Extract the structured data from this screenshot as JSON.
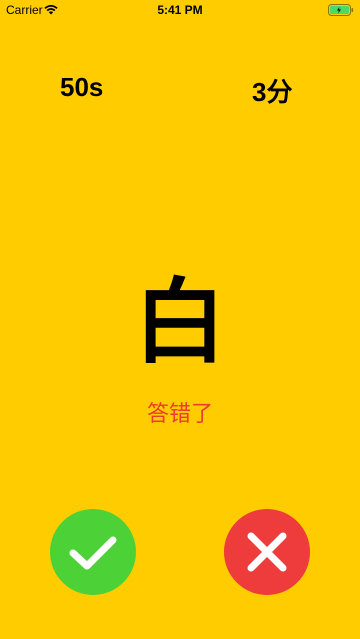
{
  "status_bar": {
    "carrier": "Carrier",
    "time": "5:41 PM",
    "wifi_icon": "wifi-icon",
    "battery_icon": "battery-icon"
  },
  "game": {
    "timer": "50s",
    "score": "3分",
    "character": "白",
    "feedback": "答错了"
  },
  "buttons": {
    "correct": {
      "icon": "checkmark-icon",
      "color": "#4CD137"
    },
    "wrong": {
      "icon": "cross-icon",
      "color": "#EE3B3B"
    }
  },
  "colors": {
    "background": "#FFCC00",
    "feedback_text": "#EE3B2E"
  }
}
